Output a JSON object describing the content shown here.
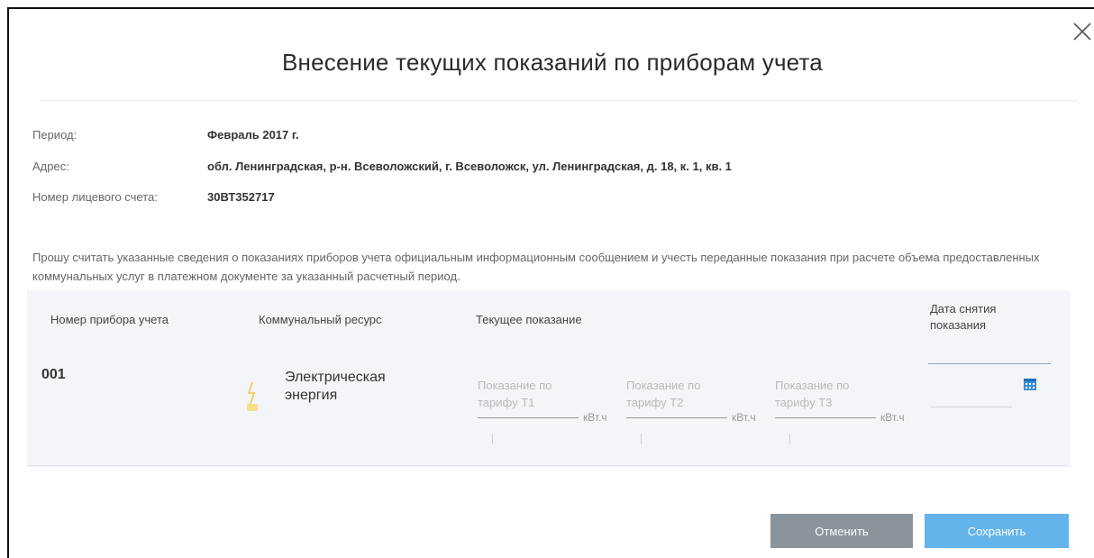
{
  "dialog": {
    "title": "Внесение текущих показаний по приборам учета",
    "close_icon": "close-icon"
  },
  "info": {
    "period_label": "Период:",
    "period_value": "Февраль 2017 г.",
    "address_label": "Адрес:",
    "address_value": "обл. Ленинградская, р-н. Всеволожский, г. Всеволожск, ул. Ленинградская, д. 18, к. 1, кв. 1",
    "account_label": "Номер лицевого счета:",
    "account_value": "30ВТ352717"
  },
  "notice": "Прошу считать указанные сведения о показаниях приборов учета официальным информационным сообщением и учесть переданные показания при расчете объема предоставленных коммунальных услуг в платежном документе за указанный расчетный период.",
  "table": {
    "headers": {
      "meter_number": "Номер прибора учета",
      "resource": "Коммунальный ресурс",
      "current_reading": "Текущее показание",
      "reading_date_1": "Дата снятия",
      "reading_date_2": "показания"
    },
    "rows": [
      {
        "meter_number": "001",
        "resource_line1": "Электрическая",
        "resource_line2": "энергия",
        "resource_icon": "lightbulb-icon",
        "tariffs": [
          {
            "placeholder_line1": "Показание по",
            "placeholder_line2": "тарифу Т1",
            "unit": "кВт.ч",
            "value": ""
          },
          {
            "placeholder_line1": "Показание по",
            "placeholder_line2": "тарифу Т2",
            "unit": "кВт.ч",
            "value": ""
          },
          {
            "placeholder_line1": "Показание по",
            "placeholder_line2": "тарифу Т3",
            "unit": "кВт.ч",
            "value": ""
          }
        ],
        "date_value": "",
        "date_icon": "calendar-icon"
      }
    ]
  },
  "buttons": {
    "cancel_label": "Отменить",
    "save_label": "Сохранить"
  },
  "colors": {
    "primary": "#63b4ea",
    "secondary": "#8b949c",
    "table_bg": "#f4f5f8"
  }
}
